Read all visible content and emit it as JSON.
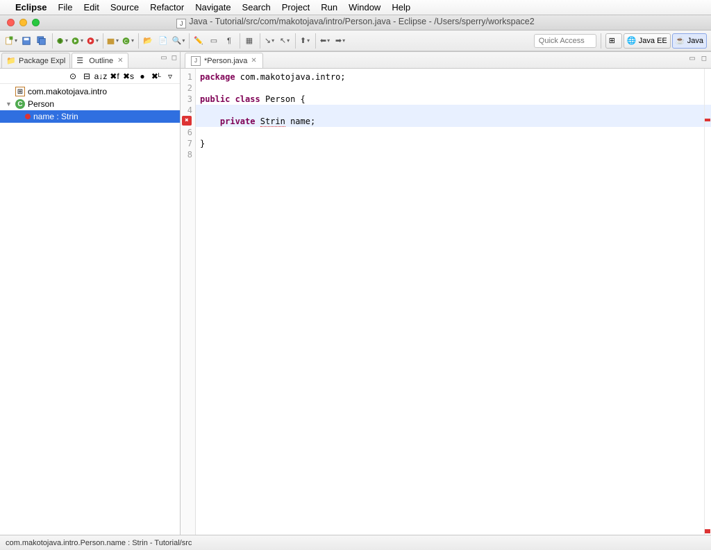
{
  "mac_menu": {
    "app": "Eclipse",
    "items": [
      "File",
      "Edit",
      "Source",
      "Refactor",
      "Navigate",
      "Search",
      "Project",
      "Run",
      "Window",
      "Help"
    ]
  },
  "window_title": "Java - Tutorial/src/com/makotojava/intro/Person.java - Eclipse - /Users/sperry/workspace2",
  "quick_access_placeholder": "Quick Access",
  "perspectives": {
    "javaee": "Java EE",
    "java": "Java"
  },
  "left_views": {
    "pkg": "Package Expl",
    "outline": "Outline"
  },
  "outline_tree": {
    "package": "com.makotojava.intro",
    "class": "Person",
    "field": "name : Strin"
  },
  "editor": {
    "tab_label": "*Person.java",
    "lines": {
      "l1_pre": "package",
      "l1_post": " com.makotojava.intro;",
      "l3_a": "public",
      "l3_b": " class",
      "l3_c": " Person {",
      "l5_a": "    private",
      "l5_b": " ",
      "l5_err": "Strin",
      "l5_c": " name;",
      "l7": "}"
    }
  },
  "status_text": "com.makotojava.intro.Person.name : Strin - Tutorial/src"
}
